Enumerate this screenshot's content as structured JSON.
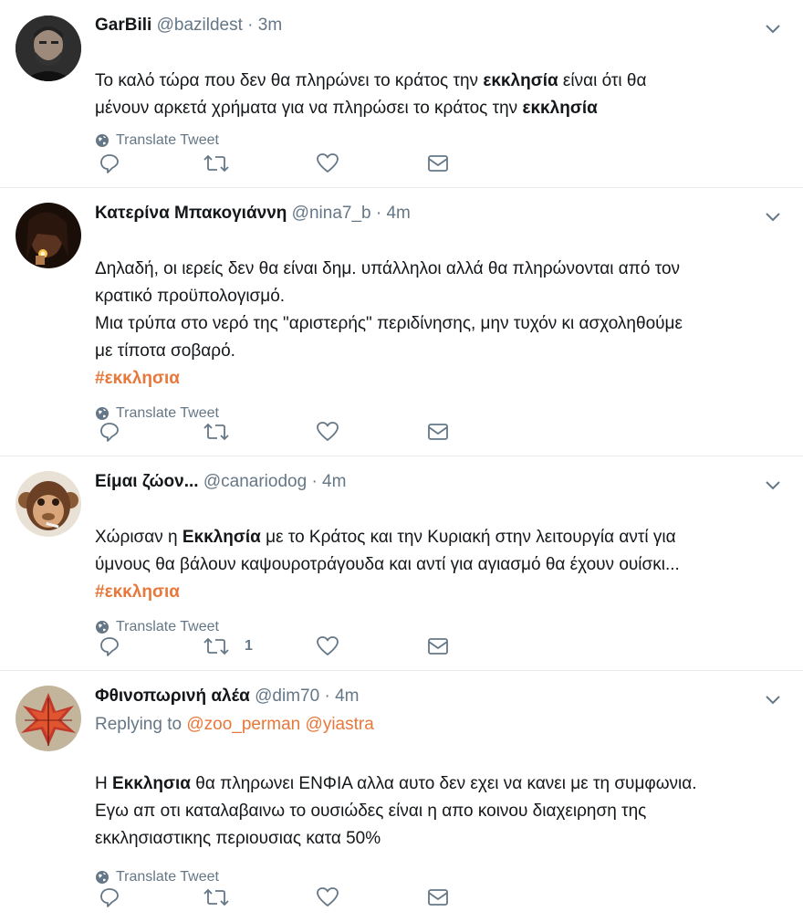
{
  "tweets": [
    {
      "name": "GarBili",
      "handle": "@bazildest",
      "sep": "·",
      "time": "3m",
      "reply_prefix": "",
      "reply_mentions": [],
      "segments": [
        {
          "t": "Το καλό τώρα που δεν θα πληρώνει το κράτος την ",
          "b": false
        },
        {
          "t": "εκκλησία",
          "b": true
        },
        {
          "t": " είναι ότι θα\nμένουν αρκετά χρήματα για να πληρώσει το κράτος την ",
          "b": false
        },
        {
          "t": "εκκλησία",
          "b": true
        }
      ],
      "hashtag": "",
      "translate": "Translate Tweet",
      "retweet_count": ""
    },
    {
      "name": "Κατερίνα Μπακογιάννη",
      "handle": "@nina7_b",
      "sep": "·",
      "time": "4m",
      "reply_prefix": "",
      "reply_mentions": [],
      "segments": [
        {
          "t": "Δηλαδή, οι ιερείς δεν θα είναι δημ. υπάλληλοι αλλά θα πληρώνονται από τον\nκρατικό προϋπολογισμό.\nΜια τρύπα στο νερό της \"αριστερής\" περιδίνησης, μην τυχόν κι ασχοληθούμε\nμε τίποτα σοβαρό.",
          "b": false
        }
      ],
      "hashtag": "#εκκλησια",
      "translate": "Translate Tweet",
      "retweet_count": ""
    },
    {
      "name": "Είμαι ζώον...",
      "handle": "@canariodog",
      "sep": "·",
      "time": "4m",
      "reply_prefix": "",
      "reply_mentions": [],
      "segments": [
        {
          "t": "Χώρισαν η ",
          "b": false
        },
        {
          "t": "Εκκλησία",
          "b": true
        },
        {
          "t": " με το Κράτος και την Κυριακή στην λειτουργία αντί για\nύμνους θα βάλουν καψουροτράγουδα και αντί για αγιασμό θα έχουν ουίσκι...",
          "b": false
        }
      ],
      "hashtag": "#εκκλησια",
      "translate": "Translate Tweet",
      "retweet_count": "1"
    },
    {
      "name": "Φθινοπωρινή αλέα",
      "handle": "@dim70",
      "sep": "·",
      "time": "4m",
      "reply_prefix": "Replying to",
      "reply_mentions": [
        "@zoo_perman",
        "@yiastra"
      ],
      "segments": [
        {
          "t": "Η ",
          "b": false
        },
        {
          "t": "Εκκλησια",
          "b": true
        },
        {
          "t": " θα πληρωνει ΕΝΦΙΑ αλλα αυτο δεν εχει να κανει με τη συμφωνια.\nΕγω απ οτι καταλαβαινω το ουσιώδες είναι η απο κοινου διαχειρηση της\nεκκλησιαστικης περιουσιας κατα 50%",
          "b": false
        }
      ],
      "hashtag": "",
      "translate": "Translate Tweet",
      "retweet_count": ""
    }
  ],
  "colors": {
    "accent": "#e8773a",
    "muted": "#657786",
    "text": "#14171a",
    "divider": "#e6ecf0"
  },
  "icons": {
    "reply": "reply-icon",
    "retweet": "retweet-icon",
    "like": "heart-icon",
    "dm": "envelope-icon",
    "globe": "globe-icon",
    "menu": "chevron-down-icon"
  }
}
